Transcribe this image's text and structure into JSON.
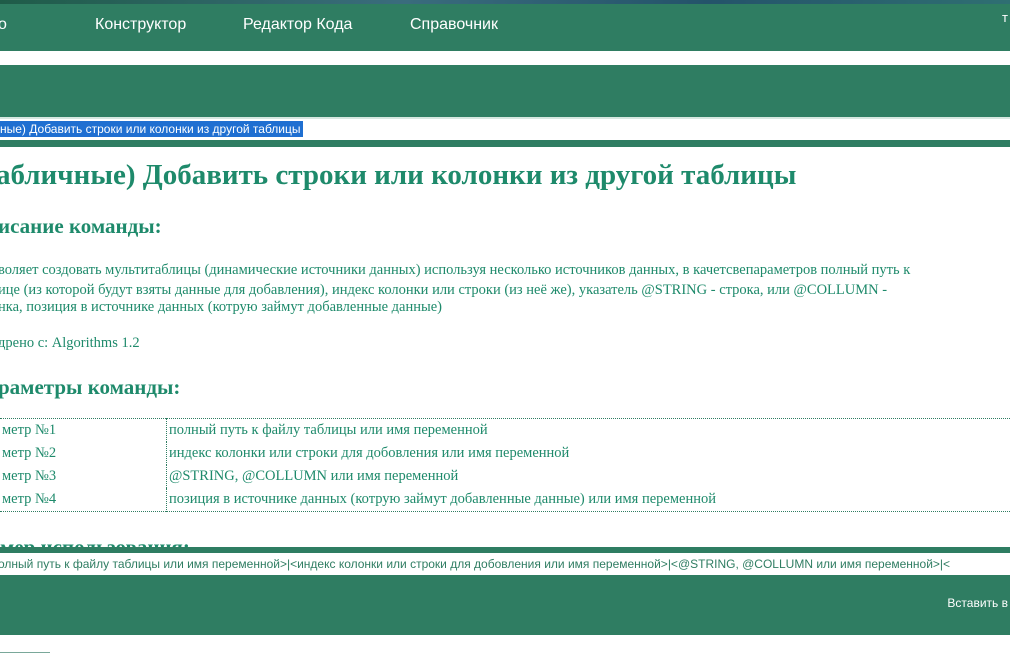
{
  "nav": {
    "items": [
      {
        "label": "о"
      },
      {
        "label": "Конструктор"
      },
      {
        "label": "Редактор Кода"
      },
      {
        "label": "Справочник"
      }
    ],
    "corner": "т"
  },
  "search": {
    "value": "ные) Добавить строки или колонки из другой таблицы"
  },
  "article": {
    "title": "абличные) Добавить строки или колонки из другой таблицы",
    "description_heading": "исание команды:",
    "description_lines": [
      "воляет создовать мультитаблицы (динамические источники данных) используя несколько источников данных, в качетсвепараметров полный путь к",
      "ице (из которой будут взяты данные для добавления), индекс колонки или строки (из неё же), указатель @STRING - строка, или @COLLUMN -",
      "нка, позиция в источнике данных (котрую займут добавленные данные)"
    ],
    "version": "дрено с: Algorithms 1.2",
    "params_heading": "раметры команды:",
    "params": [
      {
        "name": "метр №1",
        "desc": "полный путь к файлу таблицы или имя переменной"
      },
      {
        "name": "метр №2",
        "desc": "индекс колонки или строки для добовления или имя переменной"
      },
      {
        "name": "метр №3",
        "desc": "@STRING, @COLLUMN или имя переменной"
      },
      {
        "name": "метр №4",
        "desc": "позиция в источнике данных (котрую займут добавленные данные) или имя переменной"
      }
    ],
    "example_heading": "мер использования:"
  },
  "code": {
    "text": "олный путь к файлу таблицы или имя переменной>|<индекс колонки или строки для добовления или имя переменной>|<@STRING, @COLLUMN или имя переменной>|<"
  },
  "bottom": {
    "insert_label": "Вставить в"
  },
  "colors": {
    "accent": "#2f7d62",
    "text": "#1e8a6b",
    "selection": "#1f6fd1"
  }
}
